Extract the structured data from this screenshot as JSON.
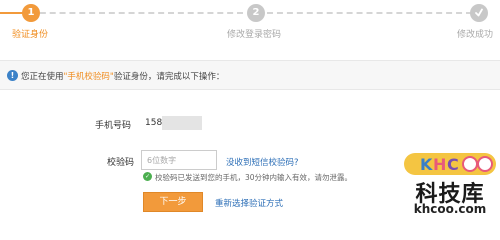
{
  "stepper": {
    "steps": [
      {
        "number": "1",
        "label": "验证身份",
        "state": "active"
      },
      {
        "number": "2",
        "label": "修改登录密码",
        "state": "pending"
      },
      {
        "number": "",
        "label": "修改成功",
        "state": "done"
      }
    ],
    "colors": {
      "active": "#f29a3b",
      "pending": "#c8c8c8"
    }
  },
  "info_bar": {
    "icon": "info-icon",
    "text_before": "您正在使用",
    "highlight": "\"手机校验码\"",
    "text_after": "验证身份，请完成以下操作："
  },
  "form": {
    "phone_label": "手机号码",
    "phone_value": "158",
    "code_label": "校验码",
    "code_placeholder": "6位数字",
    "code_value": "",
    "no_sms_link": "没收到短信校验码?",
    "sent_message": "校验码已发送到您的手机，30分钟内输入有效，请勿泄露。",
    "next_button": "下一步",
    "reselect_link": "重新选择验证方式"
  },
  "watermark": {
    "logo_text": "KHCOO",
    "chinese": "科技库",
    "url": "khcoo.com"
  }
}
